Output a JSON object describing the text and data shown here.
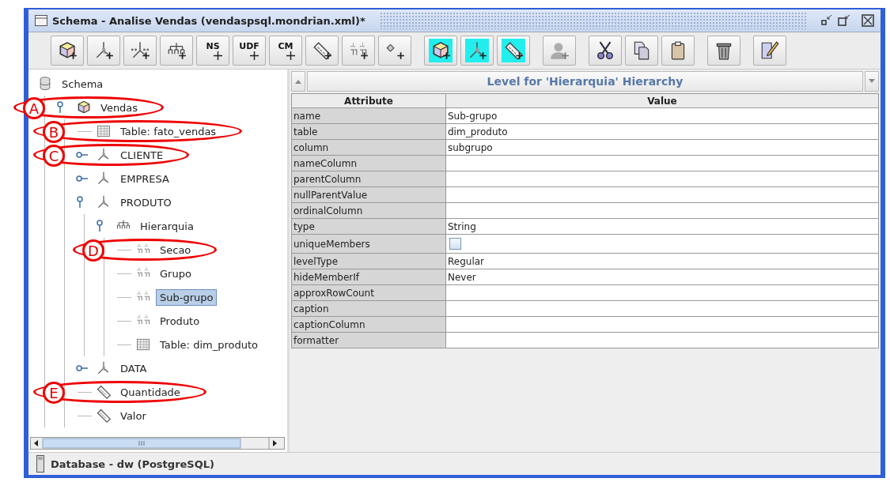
{
  "window": {
    "title": "Schema - Analise Vendas (vendaspsql.mondrian.xml)*"
  },
  "toolbar": [
    {
      "buttons": [
        {
          "kind": "cube",
          "add": true,
          "highlighted": false,
          "disabled": false
        },
        {
          "kind": "dimension",
          "add": true,
          "highlighted": false,
          "disabled": false
        },
        {
          "kind": "dimension-usage",
          "add": true,
          "highlighted": false,
          "disabled": false
        },
        {
          "kind": "hierarchy",
          "add": true,
          "highlighted": false,
          "disabled": false
        },
        {
          "kind": "text",
          "label": "NS",
          "add": true,
          "highlighted": false,
          "disabled": false
        },
        {
          "kind": "text",
          "label": "UDF",
          "add": true,
          "highlighted": false,
          "disabled": false
        },
        {
          "kind": "text",
          "label": "CM",
          "add": true,
          "highlighted": false,
          "disabled": false
        },
        {
          "kind": "measure",
          "add": true,
          "highlighted": false,
          "disabled": false
        },
        {
          "kind": "level",
          "add": true,
          "highlighted": false,
          "disabled": false
        },
        {
          "kind": "property",
          "add": true,
          "highlighted": false,
          "disabled": false
        }
      ]
    },
    {
      "buttons": [
        {
          "kind": "cube",
          "add": true,
          "highlighted": true,
          "disabled": false
        },
        {
          "kind": "dimension",
          "add": true,
          "highlighted": true,
          "disabled": false
        },
        {
          "kind": "measure",
          "add": true,
          "highlighted": true,
          "disabled": false
        }
      ]
    },
    {
      "buttons": [
        {
          "kind": "person",
          "add": true,
          "highlighted": false,
          "disabled": true
        }
      ]
    },
    {
      "buttons": [
        {
          "kind": "scissors",
          "add": false,
          "highlighted": false,
          "disabled": false
        },
        {
          "kind": "copy",
          "add": false,
          "highlighted": false,
          "disabled": false
        },
        {
          "kind": "paste",
          "add": false,
          "highlighted": false,
          "disabled": false
        }
      ]
    },
    {
      "buttons": [
        {
          "kind": "trash",
          "add": false,
          "highlighted": false,
          "disabled": false
        }
      ]
    },
    {
      "buttons": [
        {
          "kind": "edit",
          "add": false,
          "highlighted": false,
          "disabled": false
        }
      ]
    }
  ],
  "tree": {
    "label": "Schema",
    "kind": "schema",
    "selected": false,
    "children": [
      {
        "label": "Vendas",
        "kind": "cube",
        "selected": false,
        "expanded": true,
        "callout": "A",
        "children": [
          {
            "label": "Table: fato_vendas",
            "kind": "table",
            "selected": false,
            "callout": "B"
          },
          {
            "label": "CLIENTE",
            "kind": "dimension",
            "selected": false,
            "expanded": false,
            "callout": "C"
          },
          {
            "label": "EMPRESA",
            "kind": "dimension",
            "selected": false,
            "expanded": false
          },
          {
            "label": "PRODUTO",
            "kind": "dimension",
            "selected": false,
            "expanded": true,
            "children": [
              {
                "label": "Hierarquia",
                "kind": "hierarchy",
                "selected": false,
                "expanded": true,
                "children": [
                  {
                    "label": "Secao",
                    "kind": "level",
                    "selected": false,
                    "callout": "D"
                  },
                  {
                    "label": "Grupo",
                    "kind": "level",
                    "selected": false
                  },
                  {
                    "label": "Sub-grupo",
                    "kind": "level",
                    "selected": true
                  },
                  {
                    "label": "Produto",
                    "kind": "level",
                    "selected": false
                  },
                  {
                    "label": "Table: dim_produto",
                    "kind": "table",
                    "selected": false
                  }
                ]
              }
            ]
          },
          {
            "label": "DATA",
            "kind": "dimension",
            "selected": false,
            "expanded": false
          },
          {
            "label": "Quantidade",
            "kind": "measure",
            "selected": false,
            "callout": "E"
          },
          {
            "label": "Valor",
            "kind": "measure",
            "selected": false
          }
        ]
      }
    ]
  },
  "properties": {
    "title": "Level for 'Hierarquia' Hierarchy",
    "columns": [
      "Attribute",
      "Value"
    ],
    "rows": [
      {
        "attribute": "name",
        "kind": "text",
        "value": "Sub-grupo"
      },
      {
        "attribute": "table",
        "kind": "text",
        "value": "dim_produto"
      },
      {
        "attribute": "column",
        "kind": "text",
        "value": "subgrupo"
      },
      {
        "attribute": "nameColumn",
        "kind": "text"
      },
      {
        "attribute": "parentColumn",
        "kind": "text"
      },
      {
        "attribute": "nullParentValue",
        "kind": "text"
      },
      {
        "attribute": "ordinalColumn",
        "kind": "text"
      },
      {
        "attribute": "type",
        "kind": "text",
        "value": "String"
      },
      {
        "attribute": "uniqueMembers",
        "kind": "checkbox",
        "checked": false
      },
      {
        "attribute": "levelType",
        "kind": "text",
        "value": "Regular"
      },
      {
        "attribute": "hideMemberIf",
        "kind": "text",
        "value": "Never"
      },
      {
        "attribute": "approxRowCount",
        "kind": "text"
      },
      {
        "attribute": "caption",
        "kind": "text"
      },
      {
        "attribute": "captionColumn",
        "kind": "text"
      },
      {
        "attribute": "formatter",
        "kind": "text"
      }
    ]
  },
  "status_bar": {
    "text": "Database - dw (PostgreSQL)"
  }
}
